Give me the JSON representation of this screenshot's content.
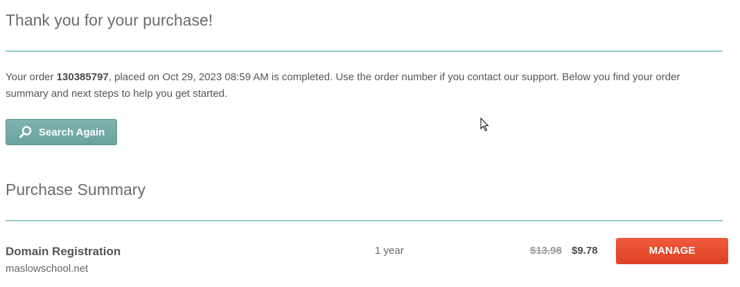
{
  "header": {
    "title": "Thank you for your purchase!"
  },
  "order": {
    "text_before": "Your order ",
    "number": "130385797",
    "text_after": ", placed on Oct 29, 2023 08:59 AM is completed. Use the order number if you contact our support. Below you find your order summary and next steps to help you get started."
  },
  "actions": {
    "search_again_label": "Search Again",
    "search_icon": "search-icon"
  },
  "summary": {
    "title": "Purchase Summary",
    "items": [
      {
        "name": "Domain Registration",
        "domain": "maslowschool.net",
        "term": "1 year",
        "old_price": "$13.98",
        "price": "$9.78",
        "action_label": "MANAGE"
      }
    ]
  },
  "colors": {
    "divider": "#8ec9c3",
    "search_button": "#72a8a5",
    "manage_button": "#e64a2c",
    "text": "#555555"
  }
}
